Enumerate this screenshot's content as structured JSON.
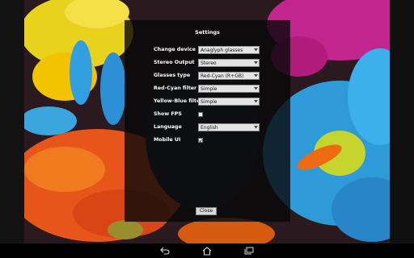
{
  "dialog": {
    "title": "Settings",
    "rows": [
      {
        "label": "Change device",
        "value": "Anaglyph glasses"
      },
      {
        "label": "Stereo Output",
        "value": "Stereo"
      },
      {
        "label": "Glasses type",
        "value": "Red-Cyan (R+GB)"
      },
      {
        "label": "Red-Cyan filter",
        "value": "Simple"
      },
      {
        "label": "Yellow-Blue filter",
        "value": "Simple"
      },
      {
        "label": "Show FPS",
        "checked": false
      },
      {
        "label": "Language",
        "value": "English"
      },
      {
        "label": "Mobile UI",
        "checked": true
      }
    ],
    "close_label": "Close"
  },
  "navbar": {
    "buttons": [
      "back-icon",
      "home-icon",
      "recent-apps-icon"
    ]
  },
  "colors": {
    "dialog_bg": "#080808",
    "select_bg": "#e4e4e4",
    "accent_cyan": "#2fa6e6",
    "accent_orange": "#f06a12"
  }
}
